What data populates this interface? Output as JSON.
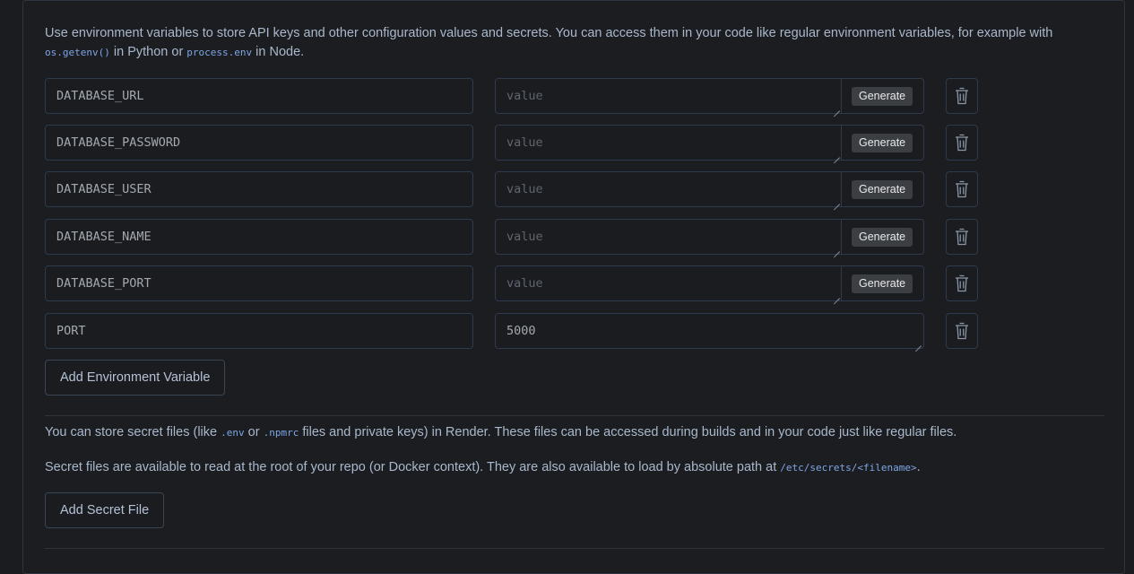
{
  "intro": {
    "text_before": "Use environment variables to store API keys and other configuration values and secrets. You can access them in your code like regular environment variables, for example with ",
    "code1": "os.getenv()",
    "text_mid": " in Python or ",
    "code2": "process.env",
    "text_after": " in Node."
  },
  "env_vars": [
    {
      "key": "DATABASE_URL",
      "value": "",
      "placeholder": "value",
      "generate_label": "Generate"
    },
    {
      "key": "DATABASE_PASSWORD",
      "value": "",
      "placeholder": "value",
      "generate_label": "Generate"
    },
    {
      "key": "DATABASE_USER",
      "value": "",
      "placeholder": "value",
      "generate_label": "Generate"
    },
    {
      "key": "DATABASE_NAME",
      "value": "",
      "placeholder": "value",
      "generate_label": "Generate"
    },
    {
      "key": "DATABASE_PORT",
      "value": "",
      "placeholder": "value",
      "generate_label": "Generate"
    },
    {
      "key": "PORT",
      "value": "5000",
      "placeholder": "value"
    }
  ],
  "add_env_button": "Add Environment Variable",
  "secret_files": {
    "p1_before": "You can store secret files (like ",
    "p1_code1": ".env",
    "p1_mid": " or ",
    "p1_code2": ".npmrc",
    "p1_after": " files and private keys) in Render. These files can be accessed during builds and in your code just like regular files.",
    "p2_before": "Secret files are available to read at the root of your repo (or Docker context). They are also available to load by absolute path at ",
    "p2_code": "/etc/secrets/<filename>",
    "p2_after": ".",
    "add_button": "Add Secret File"
  },
  "icons": {
    "delete": "trash-icon"
  },
  "colors": {
    "background": "#1a1c1f",
    "border": "#2d3b4e",
    "text": "#a9b8cc",
    "code": "#7ea6e6",
    "generate_bg": "#3b3e43"
  }
}
